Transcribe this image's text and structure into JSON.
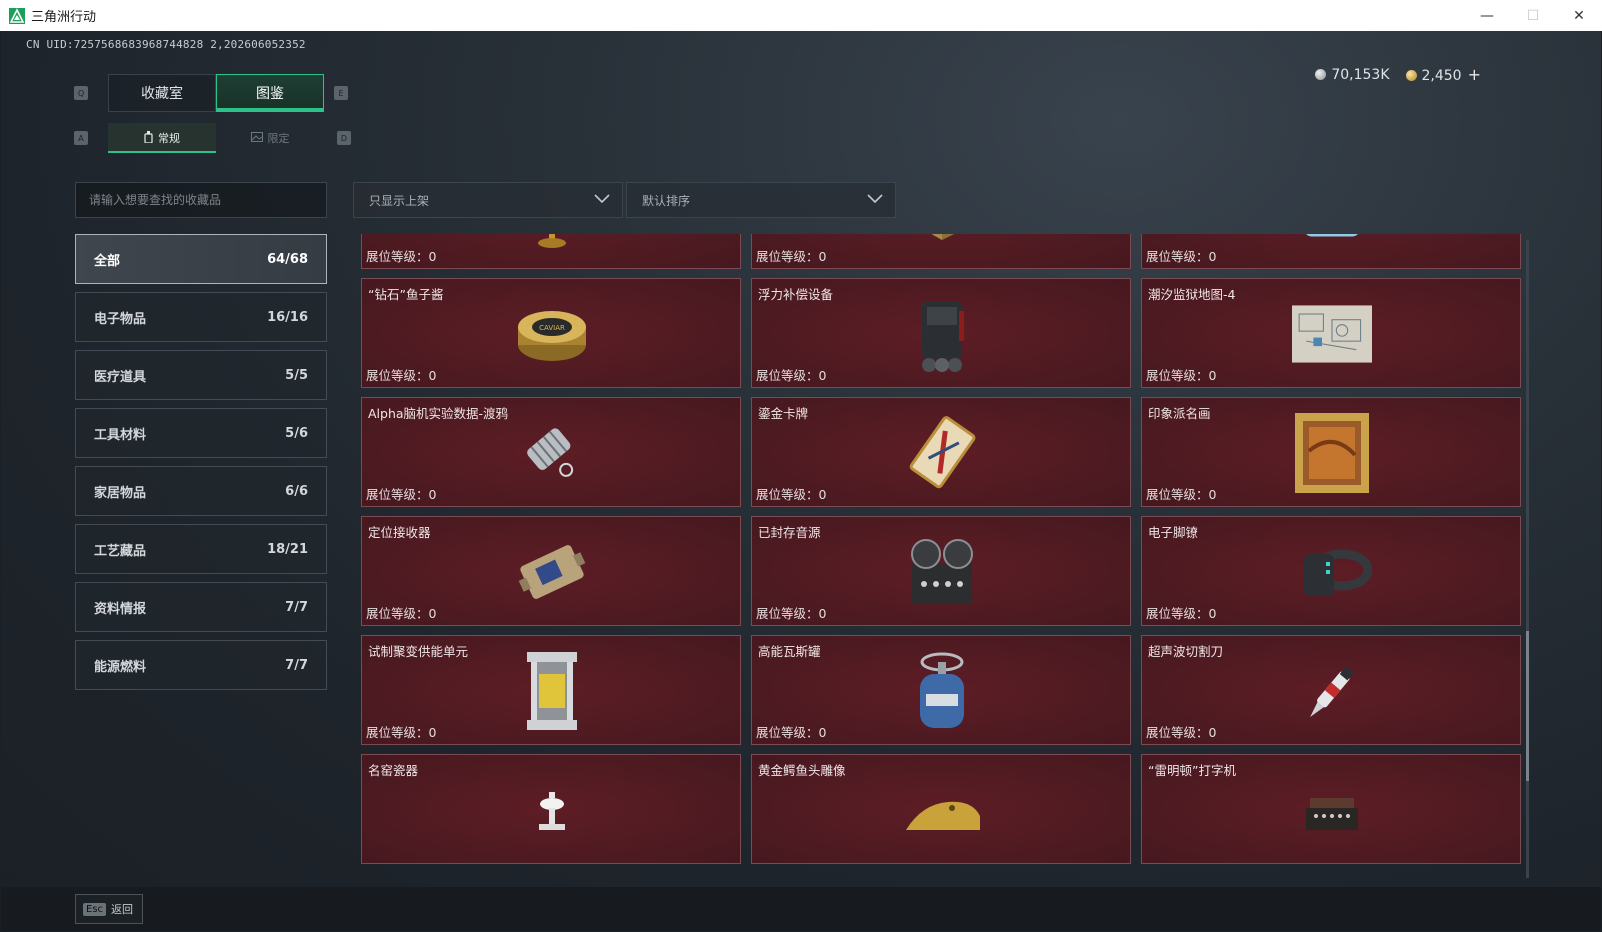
{
  "window": {
    "title": "三角洲行动",
    "controls": [
      "—",
      "☐",
      "✕"
    ]
  },
  "uid": "CN UID:7257568683968744828 2,202606052352",
  "currency": {
    "silver": "70,153K",
    "gold": "2,450",
    "plus": "+"
  },
  "keys": {
    "q": "Q",
    "e": "E",
    "a": "A",
    "d": "D"
  },
  "tabs": [
    {
      "label": "收藏室"
    },
    {
      "label": "图鉴"
    }
  ],
  "subtabs": [
    {
      "label": "常规"
    },
    {
      "label": "限定"
    }
  ],
  "search": {
    "placeholder": "请输入想要查找的收藏品"
  },
  "filters": {
    "shelf": "只显示上架",
    "sort": "默认排序"
  },
  "categories": [
    {
      "label": "全部",
      "count": "64/68"
    },
    {
      "label": "电子物品",
      "count": "16/16"
    },
    {
      "label": "医疗道具",
      "count": "5/5"
    },
    {
      "label": "工具材料",
      "count": "5/6"
    },
    {
      "label": "家居物品",
      "count": "6/6"
    },
    {
      "label": "工艺藏品",
      "count": "18/21"
    },
    {
      "label": "资料情报",
      "count": "7/7"
    },
    {
      "label": "能源燃料",
      "count": "7/7"
    }
  ],
  "cards": [
    {
      "name": "",
      "level": "展位等级：0",
      "icon": "armillary-sphere-icon"
    },
    {
      "name": "",
      "level": "展位等级：0",
      "icon": "chess-box-icon"
    },
    {
      "name": "",
      "level": "展位等级：0",
      "icon": "robot-toy-icon"
    },
    {
      "name": "“钻石”鱼子酱",
      "level": "展位等级：0",
      "icon": "caviar-tin-icon"
    },
    {
      "name": "浮力补偿设备",
      "level": "展位等级：0",
      "icon": "buoyancy-device-icon"
    },
    {
      "name": "潮汐监狱地图-4",
      "level": "展位等级：0",
      "icon": "blueprint-map-icon"
    },
    {
      "name": "Alpha脑机实验数据-渡鸦",
      "level": "展位等级：0",
      "icon": "data-capsule-icon"
    },
    {
      "name": "鎏金卡牌",
      "level": "展位等级：0",
      "icon": "gilded-card-icon"
    },
    {
      "name": "印象派名画",
      "level": "展位等级：0",
      "icon": "framed-painting-icon"
    },
    {
      "name": "定位接收器",
      "level": "展位等级：0",
      "icon": "locator-receiver-icon"
    },
    {
      "name": "已封存音源",
      "level": "展位等级：0",
      "icon": "reel-recorder-icon"
    },
    {
      "name": "电子脚镣",
      "level": "展位等级：0",
      "icon": "ankle-monitor-icon"
    },
    {
      "name": "试制聚变供能单元",
      "level": "展位等级：0",
      "icon": "fusion-cell-icon"
    },
    {
      "name": "高能瓦斯罐",
      "level": "展位等级：0",
      "icon": "gas-canister-icon"
    },
    {
      "name": "超声波切割刀",
      "level": "展位等级：0",
      "icon": "ultrasonic-knife-icon"
    },
    {
      "name": "名窑瓷器",
      "level": "",
      "icon": "porcelain-icon"
    },
    {
      "name": "黄金鳄鱼头雕像",
      "level": "",
      "icon": "gold-croc-head-icon"
    },
    {
      "name": "“雷明顿”打字机",
      "level": "",
      "icon": "typewriter-icon"
    }
  ],
  "footer": {
    "esc_key": "Esc",
    "back": "返回"
  },
  "colors": {
    "accent": "#2ec18a",
    "card_bg": "#4d1a21",
    "card_border": "#7c4a50"
  }
}
